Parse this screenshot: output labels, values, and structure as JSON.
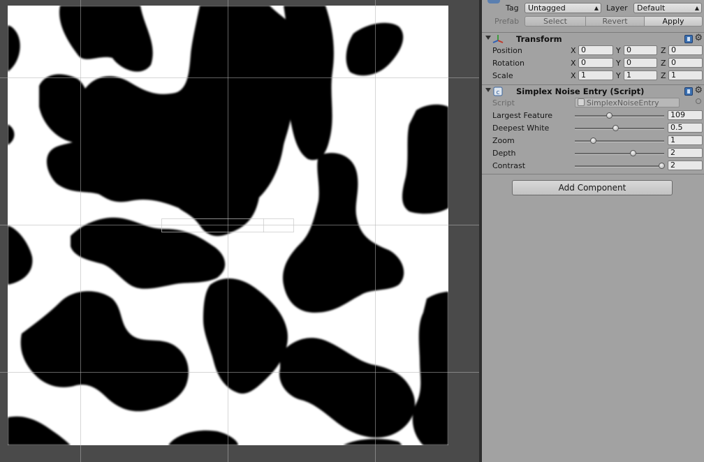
{
  "inspector": {
    "tag_label": "Tag",
    "tag_value": "Untagged",
    "layer_label": "Layer",
    "layer_value": "Default",
    "prefab_label": "Prefab",
    "prefab_buttons": [
      "Select",
      "Revert",
      "Apply"
    ],
    "transform": {
      "title": "Transform",
      "rows": [
        {
          "label": "Position",
          "x": "0",
          "y": "0",
          "z": "0"
        },
        {
          "label": "Rotation",
          "x": "0",
          "y": "0",
          "z": "0"
        },
        {
          "label": "Scale",
          "x": "1",
          "y": "1",
          "z": "1"
        }
      ],
      "axis_x": "X",
      "axis_y": "Y",
      "axis_z": "Z"
    },
    "noise_component": {
      "title": "Simplex Noise Entry (Script)",
      "script_label": "Script",
      "script_value": "SimplexNoiseEntry",
      "sliders": [
        {
          "label": "Largest Feature",
          "value": "109",
          "fraction": 0.38
        },
        {
          "label": "Deepest White",
          "value": "0.5",
          "fraction": 0.45
        },
        {
          "label": "Zoom",
          "value": "1",
          "fraction": 0.2
        },
        {
          "label": "Depth",
          "value": "2",
          "fraction": 0.65
        },
        {
          "label": "Contrast",
          "value": "2",
          "fraction": 0.97
        }
      ]
    },
    "add_component_label": "Add Component"
  },
  "icons": [
    "transform-axes-icon",
    "script-icon",
    "help-book-icon",
    "gear-icon",
    "foldout-arrow-icon",
    "object-picker-icon"
  ],
  "colors": {
    "inspector_bg": "#a2a2a2",
    "scene_bg": "#4a4a4a",
    "noise_black": "#000000",
    "noise_white": "#ffffff"
  }
}
